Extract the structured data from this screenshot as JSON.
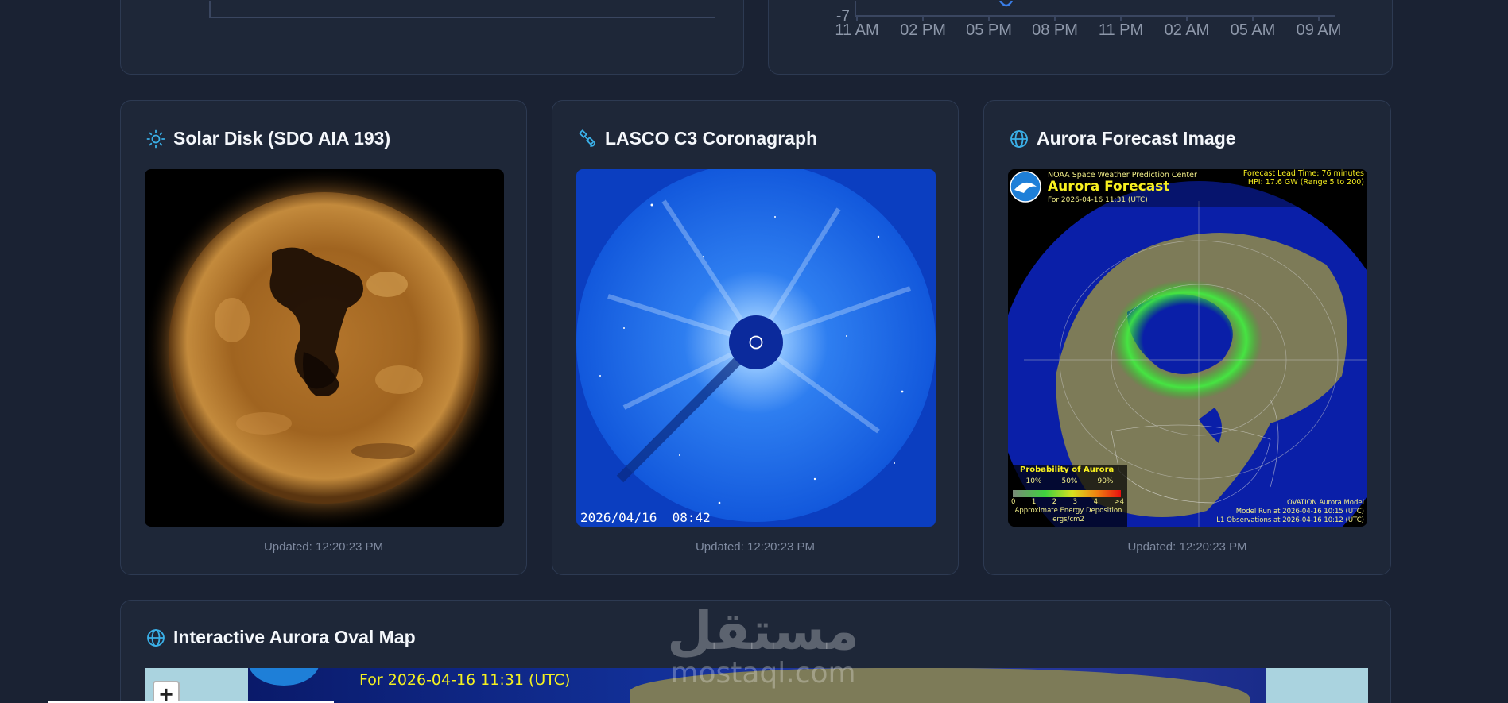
{
  "top_chart": {
    "y_tick": "-7",
    "x_ticks": [
      "11 AM",
      "02 PM",
      "05 PM",
      "08 PM",
      "11 PM",
      "02 AM",
      "05 AM",
      "09 AM"
    ]
  },
  "cards": [
    {
      "title": "Solar Disk (SDO AIA 193)",
      "icon": "sun-icon",
      "updated": "Updated: 12:20:23 PM"
    },
    {
      "title": "LASCO C3 Coronagraph",
      "icon": "satellite-icon",
      "updated": "Updated: 12:20:23 PM",
      "image_timestamp": "2026/04/16  08:42"
    },
    {
      "title": "Aurora Forecast Image",
      "icon": "globe-icon",
      "updated": "Updated: 12:20:23 PM",
      "image": {
        "center": "NOAA Space Weather Prediction Center",
        "title": "Aurora Forecast",
        "for": "For 2026-04-16 11:31 (UTC)",
        "lead": "Forecast Lead Time:  76 minutes",
        "hpi": "HPI:  17.6 GW (Range 5 to 200)",
        "legend_title": "Probability of Aurora",
        "legend_pcts": [
          "10%",
          "50%",
          "90%"
        ],
        "legend_nums": [
          "0",
          "1",
          "2",
          "3",
          "4",
          ">4"
        ],
        "legend_note": "Approximate Energy Deposition",
        "legend_unit": "ergs/cm2",
        "model": "OVATION Aurora Model",
        "model_run": "Model Run at 2026-04-16 10:15 (UTC)",
        "l1": "L1 Observations at 2026-04-16 10:12 (UTC)",
        "noaa": "NOAA"
      }
    }
  ],
  "map_card": {
    "title": "Interactive Aurora Oval Map",
    "icon": "globe-icon",
    "zoom_in": "+",
    "banner": "For 2026-04-16 11:31 (UTC)"
  },
  "watermark": {
    "arabic": "مستقل",
    "latin": "mostaql.com"
  },
  "colors": {
    "background": "#1a2233",
    "card": "#1e2738",
    "accent": "#3ab0e8"
  }
}
